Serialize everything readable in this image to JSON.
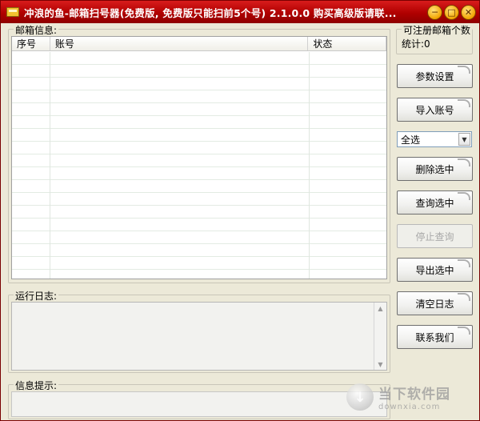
{
  "titlebar": {
    "title": "冲浪的鱼-邮箱扫号器(免费版, 免费版只能扫前5个号) 2.1.0.0  购买高级版请联...",
    "minimize_glyph": "─",
    "maximize_glyph": "□",
    "close_glyph": "✕"
  },
  "mail_group": {
    "label": "邮箱信息:",
    "columns": [
      "序号",
      "账号",
      "状态"
    ]
  },
  "count_group": {
    "label": "可注册邮箱个数",
    "count_text": "统计:0"
  },
  "buttons": {
    "params": "参数设置",
    "import": "导入账号",
    "delete_selected": "删除选中",
    "query_selected": "查询选中",
    "stop_query": "停止查询",
    "export_selected": "导出选中",
    "clear_log": "清空日志",
    "contact": "联系我们"
  },
  "select": {
    "value": "全选"
  },
  "log_group": {
    "label": "运行日志:"
  },
  "info_group": {
    "label": "信息提示:"
  },
  "watermark": {
    "cn": "当下软件园",
    "en": "downxia.com"
  }
}
